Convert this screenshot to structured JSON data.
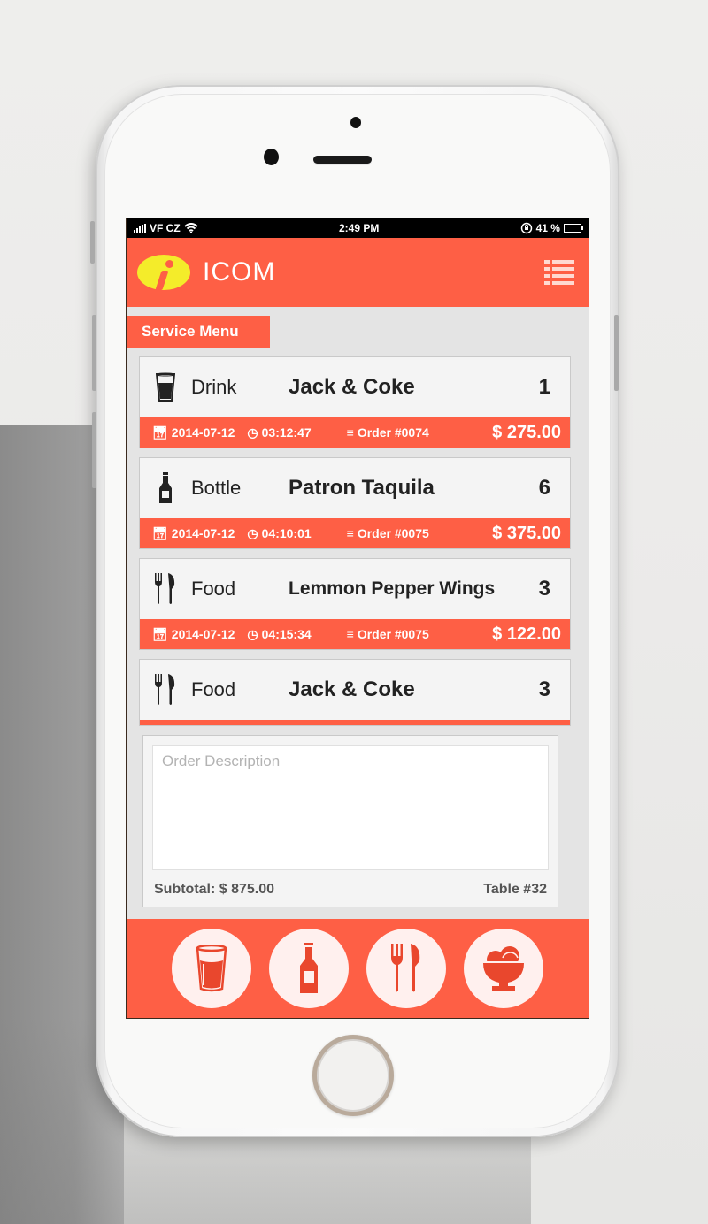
{
  "status_bar": {
    "carrier": "VF CZ",
    "time": "2:49 PM",
    "battery_percent": "41 %",
    "battery_level": 0.41
  },
  "app": {
    "brand_name": "ICOM",
    "section_title": "Service Menu"
  },
  "orders": [
    {
      "type": "Drink",
      "type_icon": "glass-icon",
      "name": "Jack & Coke",
      "qty": "1",
      "date": "2014-07-12",
      "time": "03:12:47",
      "order": "Order #0074",
      "price": "$ 275.00"
    },
    {
      "type": "Bottle",
      "type_icon": "bottle-icon",
      "name": "Patron Taquila",
      "qty": "6",
      "date": "2014-07-12",
      "time": "04:10:01",
      "order": "Order #0075",
      "price": "$ 375.00"
    },
    {
      "type": "Food",
      "type_icon": "fork-knife-icon",
      "name": "Lemmon Pepper Wings",
      "qty": "3",
      "date": "2014-07-12",
      "time": "04:15:34",
      "order": "Order #0075",
      "price": "$ 122.00"
    },
    {
      "type": "Food",
      "type_icon": "fork-knife-icon",
      "name": "Jack & Coke",
      "qty": "3"
    }
  ],
  "description": {
    "placeholder": "Order Description",
    "value": ""
  },
  "summary": {
    "subtotal": "Subtotal: $ 875.00",
    "table": "Table #32"
  },
  "bottom_nav": [
    {
      "icon": "glass-icon",
      "label": "Drink"
    },
    {
      "icon": "bottle-icon",
      "label": "Bottle"
    },
    {
      "icon": "fork-knife-icon",
      "label": "Food"
    },
    {
      "icon": "ice-cream-icon",
      "label": "Dessert"
    }
  ],
  "colors": {
    "accent": "#fe5f45",
    "logo_yellow": "#f4ec2a",
    "icon_fill": "#e9472d",
    "background": "#e4e4e4"
  }
}
